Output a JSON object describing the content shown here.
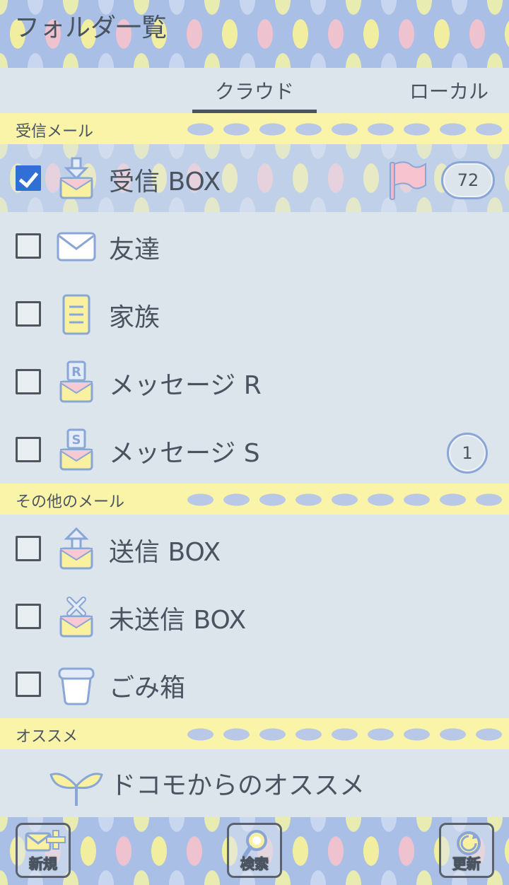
{
  "header": {
    "title": "フォルダ一覧"
  },
  "tabs": [
    {
      "label": "クラウド",
      "active": true
    },
    {
      "label": "ローカル",
      "active": false
    }
  ],
  "sections": {
    "inbox": {
      "label": "受信メール"
    },
    "other": {
      "label": "その他のメール"
    },
    "reco": {
      "label": "オススメ"
    }
  },
  "folders": [
    {
      "label": "受信 BOX",
      "checked": true,
      "icon": "inbox-envelope-icon",
      "badge": "72",
      "flag": true
    },
    {
      "label": "友達",
      "checked": false,
      "icon": "envelope-icon"
    },
    {
      "label": "家族",
      "checked": false,
      "icon": "document-icon"
    },
    {
      "label": "メッセージ R",
      "checked": false,
      "icon": "message-r-icon"
    },
    {
      "label": "メッセージ S",
      "checked": false,
      "icon": "message-s-icon",
      "badge": "1"
    },
    {
      "label": "送信 BOX",
      "checked": false,
      "icon": "outbox-envelope-icon"
    },
    {
      "label": "未送信 BOX",
      "checked": false,
      "icon": "unsent-envelope-icon"
    },
    {
      "label": "ごみ箱",
      "checked": false,
      "icon": "trash-icon"
    }
  ],
  "recommend": {
    "label": "ドコモからのオススメ",
    "icon": "sprout-icon"
  },
  "toolbar": {
    "new_label": "新規",
    "search_label": "検索",
    "refresh_label": "更新"
  },
  "colors": {
    "accent": "#2f6fd6",
    "section_bg": "#faf4a8",
    "page_bg": "#dce5ec",
    "envelope_pink": "#f7c9d3",
    "envelope_yellow": "#faf1a0"
  }
}
